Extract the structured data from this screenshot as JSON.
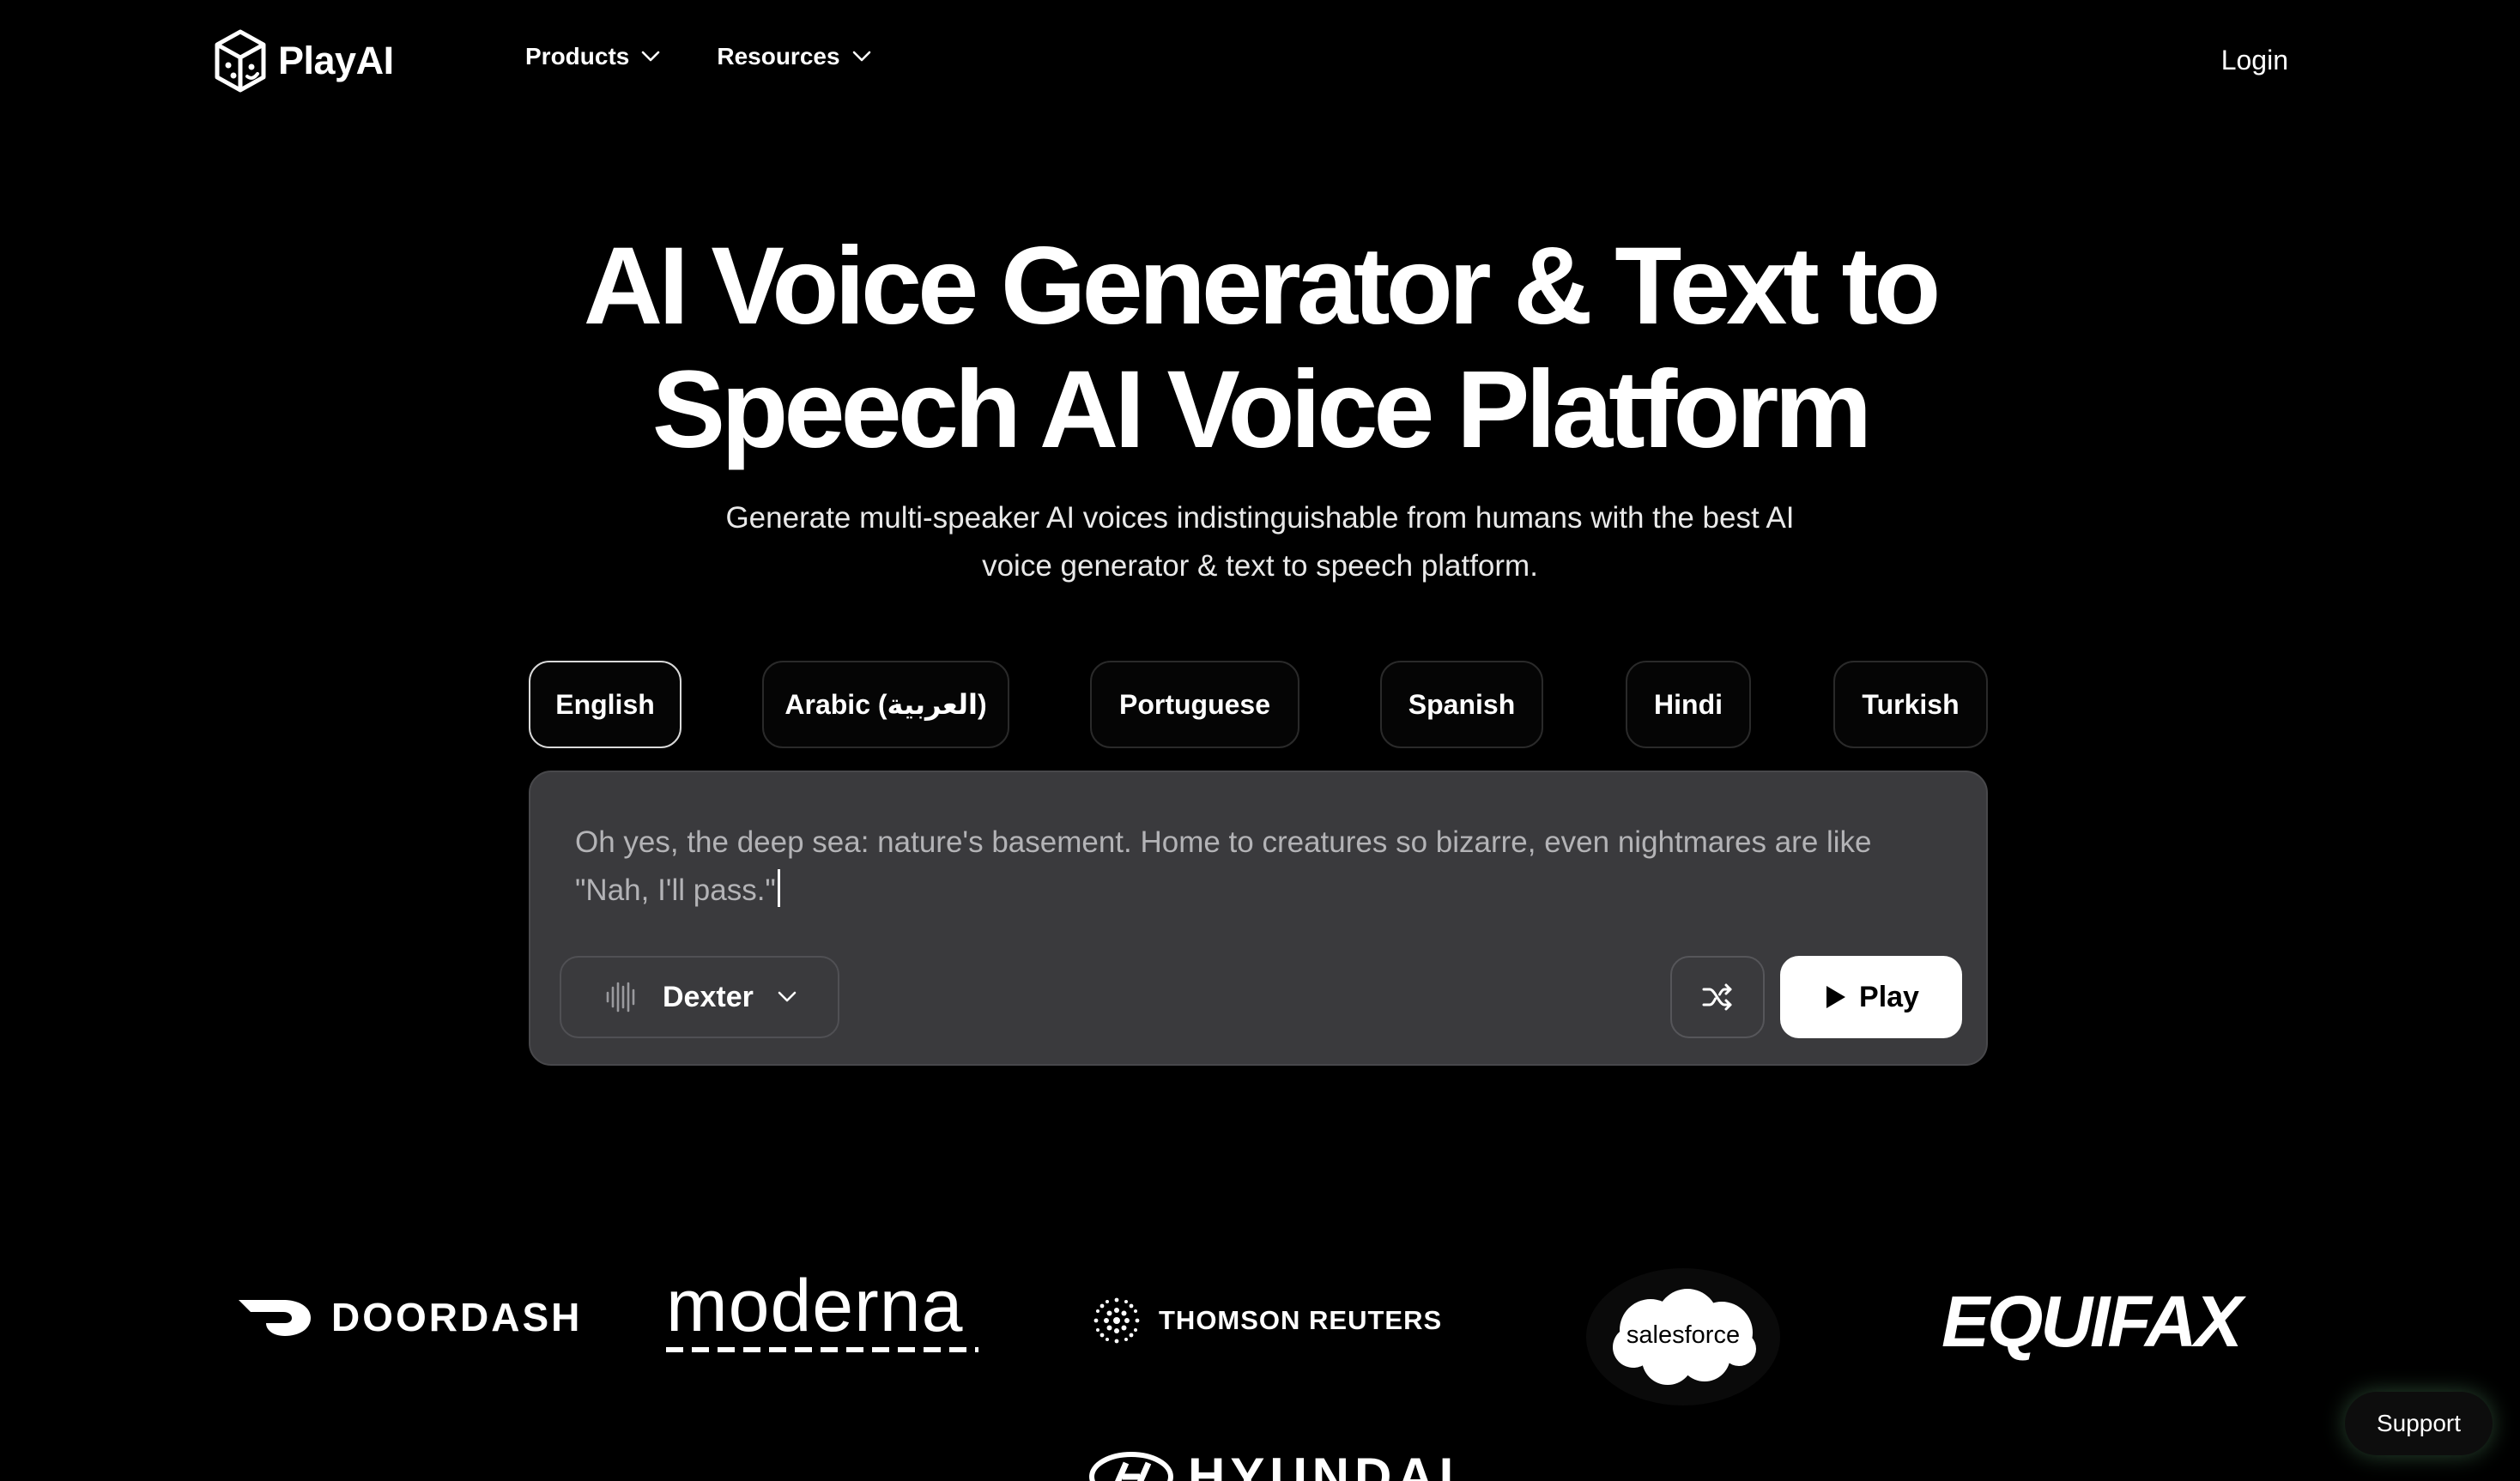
{
  "nav": {
    "brand": "PlayAI",
    "links": [
      {
        "label": "Products"
      },
      {
        "label": "Resources"
      }
    ],
    "login": "Login"
  },
  "hero": {
    "title_line1": "AI Voice Generator & Text to",
    "title_line2": "Speech AI Voice Platform",
    "subtitle_line1": "Generate multi-speaker AI voices indistinguishable from humans with the best AI",
    "subtitle_line2": "voice generator & text to speech platform."
  },
  "languages": {
    "active": "English",
    "tabs": [
      "English",
      "Arabic (العربية)",
      "Portuguese",
      "Spanish",
      "Hindi",
      "Turkish"
    ]
  },
  "editor": {
    "text_line1": "Oh yes, the deep sea: nature's basement. Home to creatures so bizarre, even nightmares are like",
    "text_line2": "\"Nah, I'll pass.\"",
    "voice": "Dexter",
    "play_label": "Play"
  },
  "logos": {
    "doordash": "DOORDASH",
    "moderna": "moderna",
    "thomson": "THOMSON REUTERS",
    "salesforce": "salesforce",
    "equifax": "EQUIFAX",
    "hyundai": "HYUNDAI"
  },
  "support": "Support"
}
